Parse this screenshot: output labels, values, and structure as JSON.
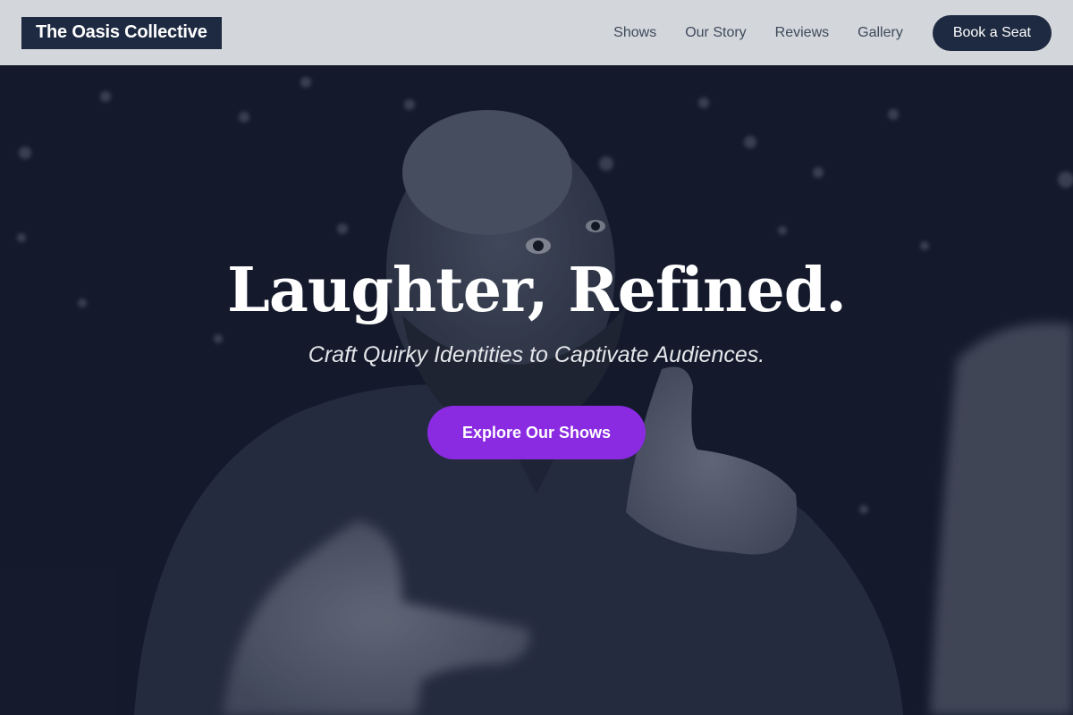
{
  "navbar": {
    "logo": "The Oasis Collective",
    "links": [
      "Shows",
      "Our Story",
      "Reviews",
      "Gallery"
    ],
    "cta_label": "Book a Seat"
  },
  "hero": {
    "title": "Laughter, Refined.",
    "subtitle": "Craft Quirky Identities to Captivate Audiences.",
    "cta_label": "Explore Our Shows",
    "background_image": "grayscale photo of a bald bearded man pointing at the viewer with both hands"
  },
  "colors": {
    "navbar_bg": "#d3d6da",
    "brand_dark": "#1e2a41",
    "accent_purple": "#8a2be2",
    "hero_overlay": "#1a2133"
  }
}
